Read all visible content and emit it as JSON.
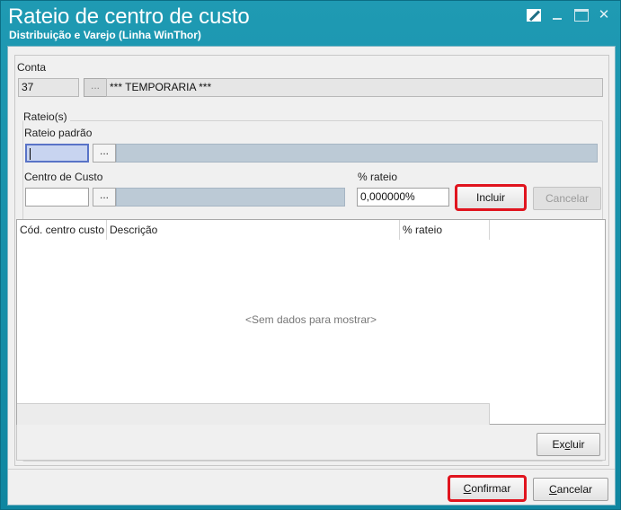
{
  "window": {
    "title": "Rateio de centro de custo",
    "subtitle": "Distribuição e Varejo (Linha WinThor)"
  },
  "conta": {
    "label": "Conta",
    "code": "37",
    "lookup_button": "...",
    "description": "*** TEMPORARIA ***"
  },
  "rateios": {
    "group_label": "Rateio(s)",
    "rateio_padrao_label": "Rateio padrão",
    "rateio_padrao_value": "",
    "rateio_padrao_lookup": "...",
    "centro_custo_label": "Centro de Custo",
    "centro_custo_value": "",
    "centro_custo_lookup": "...",
    "percent_label": "% rateio",
    "percent_value": "0,000000%",
    "incluir_button": "Incluir",
    "cancelar_button": "Cancelar"
  },
  "grid": {
    "columns": [
      "Cód. centro custo",
      "Descrição",
      "% rateio"
    ],
    "empty_text": "<Sem dados para mostrar>",
    "excluir_button_prefix": "Ex",
    "excluir_button_accel": "c",
    "excluir_button_suffix": "luir"
  },
  "footer": {
    "confirmar_accel": "C",
    "confirmar_rest": "onfirmar",
    "cancelar_accel": "C",
    "cancelar_rest": "ancelar"
  },
  "colors": {
    "titlebar": "#1f9ab3",
    "highlight_outline": "#e0141e",
    "readonly_blue": "#bccad6"
  }
}
